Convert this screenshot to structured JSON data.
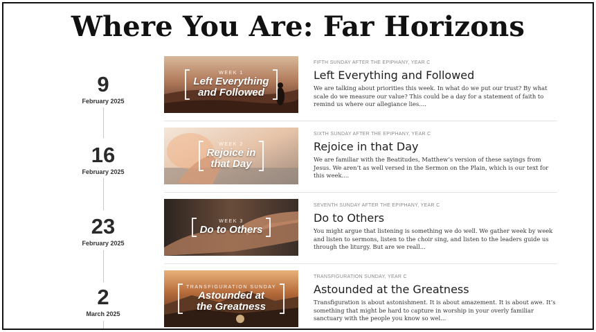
{
  "page": {
    "title": "Where You Are: Far Horizons"
  },
  "sermons": [
    {
      "day": "9",
      "month": "February 2025",
      "week_tag": "WEEK 1",
      "thumb_title_line1": "Left Everything",
      "thumb_title_line2": "and Followed",
      "occasion": "FIFTH SUNDAY AFTER THE EPIPHANY, YEAR C",
      "title": "Left Everything and Followed",
      "excerpt": "We are talking about priorities this week. In what do we put our trust? By what scale do we measure our value? This could be a day for a statement of faith to remind us where our allegiance lies...."
    },
    {
      "day": "16",
      "month": "February 2025",
      "week_tag": "WEEK 2",
      "thumb_title_line1": "Rejoice in",
      "thumb_title_line2": "that Day",
      "occasion": "SIXTH SUNDAY AFTER THE EPIPHANY, YEAR C",
      "title": "Rejoice in that Day",
      "excerpt": "We are familiar with the Beatitudes, Matthew’s version of these sayings from Jesus. We aren’t as well versed in the Sermon on the Plain, which is our text for this week...."
    },
    {
      "day": "23",
      "month": "February 2025",
      "week_tag": "WEEK 3",
      "thumb_title_line1": "Do to Others",
      "thumb_title_line2": "",
      "occasion": "SEVENTH SUNDAY AFTER THE EPIPHANY, YEAR C",
      "title": "Do to Others",
      "excerpt": "You might argue that listening is something we do well. We gather week by week and listen to sermons, listen to the choir sing, and listen to the leaders guide us through the liturgy. But are we reall..."
    },
    {
      "day": "2",
      "month": "March 2025",
      "week_tag": "TRANSFIGURATION SUNDAY",
      "thumb_title_line1": "Astounded at",
      "thumb_title_line2": "the Greatness",
      "occasion": "TRANSFIGURATION SUNDAY, YEAR C",
      "title": "Astounded at the Greatness",
      "excerpt": "Transfiguration is about astonishment. It is about amazement. It is about awe. It’s something that might be hard to capture in worship in your overly familiar sanctuary with the people you know so wel..."
    }
  ]
}
